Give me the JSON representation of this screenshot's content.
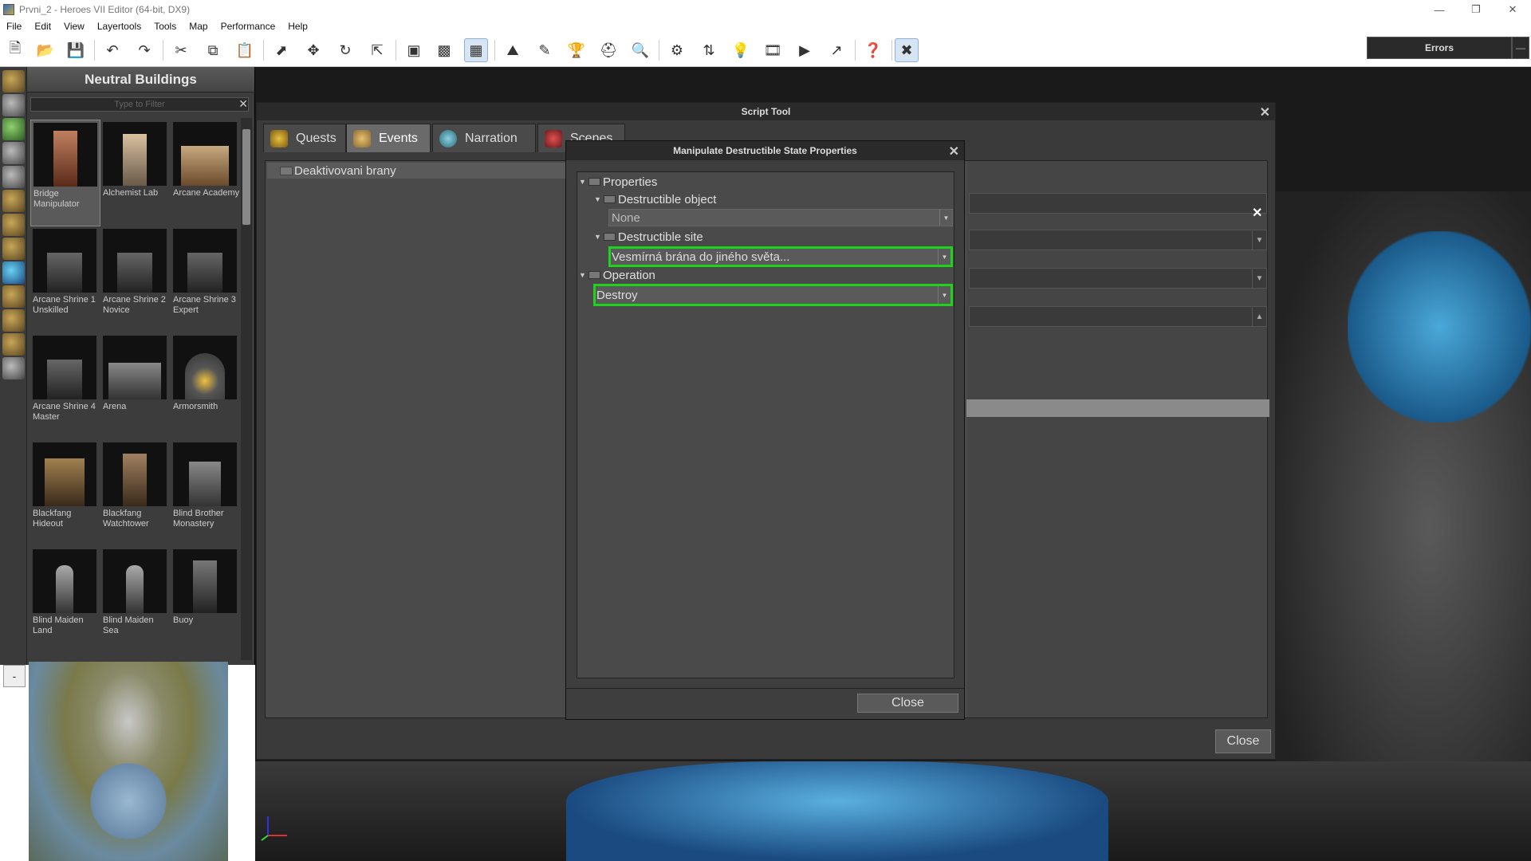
{
  "window": {
    "title": "Prvni_2 - Heroes VII Editor (64-bit, DX9)"
  },
  "menu": [
    "File",
    "Edit",
    "View",
    "Layertools",
    "Tools",
    "Map",
    "Performance",
    "Help"
  ],
  "toolbar": {
    "errors_label": "Errors"
  },
  "neutral_buildings": {
    "title": "Neutral Buildings",
    "filter_placeholder": "Type to Filter",
    "items": [
      {
        "label": "Bridge Manipulator"
      },
      {
        "label": "Alchemist Lab"
      },
      {
        "label": "Arcane Academy"
      },
      {
        "label": "Arcane Shrine 1 Unskilled"
      },
      {
        "label": "Arcane Shrine 2 Novice"
      },
      {
        "label": "Arcane Shrine 3 Expert"
      },
      {
        "label": "Arcane Shrine 4 Master"
      },
      {
        "label": "Arena"
      },
      {
        "label": "Armorsmith"
      },
      {
        "label": "Blackfang Hideout"
      },
      {
        "label": "Blackfang Watchtower"
      },
      {
        "label": "Blind Brother Monastery"
      },
      {
        "label": "Blind Maiden Land"
      },
      {
        "label": "Blind Maiden Sea"
      },
      {
        "label": "Buoy"
      }
    ]
  },
  "minimap": {
    "toggle_label": "-"
  },
  "script_tool": {
    "title": "Script Tool",
    "tabs": [
      {
        "label": "Quests"
      },
      {
        "label": "Events"
      },
      {
        "label": "Narration"
      },
      {
        "label": "Scenes"
      }
    ],
    "tree_item": "Deaktivovani brany",
    "close_label": "Close"
  },
  "manipulate_dialog": {
    "title": "Manipulate Destructible State Properties",
    "properties_label": "Properties",
    "destructible_object_label": "Destructible object",
    "destructible_object_value": "None",
    "destructible_site_label": "Destructible site",
    "destructible_site_value": "Vesmírná brána do jiného světa...",
    "operation_label": "Operation",
    "operation_value": "Destroy",
    "close_label": "Close"
  },
  "colors": {
    "highlight": "#1ed21e",
    "panel_bg": "#3c3c3c"
  }
}
